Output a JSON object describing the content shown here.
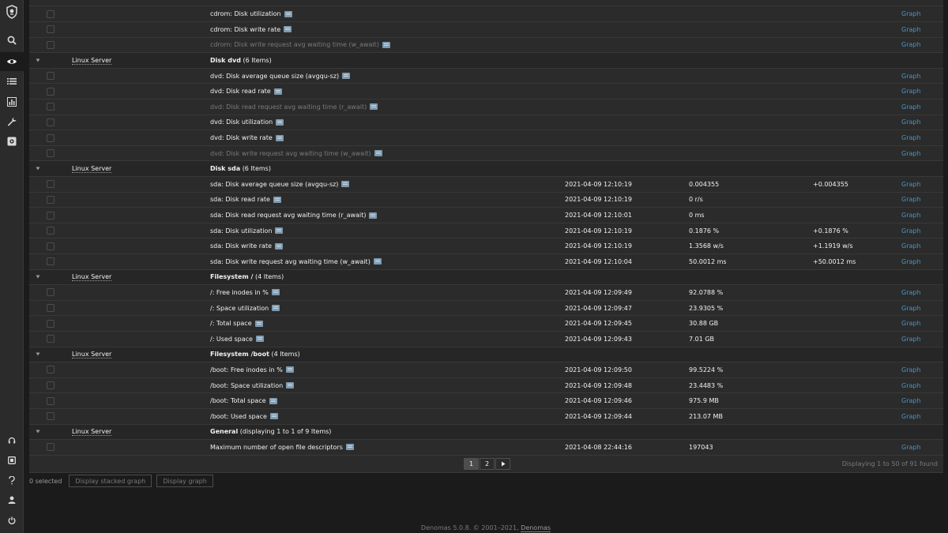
{
  "sidebar": {
    "icons": [
      "logo-icon",
      "search-icon",
      "eye-icon",
      "list-icon",
      "chart-icon",
      "wrench-icon",
      "settings-icon",
      "support-icon",
      "share-icon",
      "help-icon",
      "user-icon",
      "power-icon"
    ]
  },
  "table": {
    "pre_rows": [
      {
        "name": "cdrom: Disk utilization",
        "graph": "Graph",
        "disabled": false
      },
      {
        "name": "cdrom: Disk write rate",
        "graph": "Graph",
        "disabled": false
      },
      {
        "name": "cdrom: Disk write request avg waiting time (w_await)",
        "graph": "Graph",
        "disabled": true
      }
    ],
    "groups": [
      {
        "host": "Linux Server",
        "name": "Disk dvd",
        "count": "(6 Items)",
        "rows": [
          {
            "name": "dvd: Disk average queue size (avgqu-sz)",
            "time": "",
            "last": "",
            "change": "",
            "graph": "Graph",
            "disabled": false
          },
          {
            "name": "dvd: Disk read rate",
            "time": "",
            "last": "",
            "change": "",
            "graph": "Graph",
            "disabled": false
          },
          {
            "name": "dvd: Disk read request avg waiting time (r_await)",
            "time": "",
            "last": "",
            "change": "",
            "graph": "Graph",
            "disabled": true
          },
          {
            "name": "dvd: Disk utilization",
            "time": "",
            "last": "",
            "change": "",
            "graph": "Graph",
            "disabled": false
          },
          {
            "name": "dvd: Disk write rate",
            "time": "",
            "last": "",
            "change": "",
            "graph": "Graph",
            "disabled": false
          },
          {
            "name": "dvd: Disk write request avg waiting time (w_await)",
            "time": "",
            "last": "",
            "change": "",
            "graph": "Graph",
            "disabled": true
          }
        ]
      },
      {
        "host": "Linux Server",
        "name": "Disk sda",
        "count": "(6 Items)",
        "rows": [
          {
            "name": "sda: Disk average queue size (avgqu-sz)",
            "time": "2021-04-09 12:10:19",
            "last": "0.004355",
            "change": "+0.004355",
            "graph": "Graph",
            "disabled": false
          },
          {
            "name": "sda: Disk read rate",
            "time": "2021-04-09 12:10:19",
            "last": "0 r/s",
            "change": "",
            "graph": "Graph",
            "disabled": false
          },
          {
            "name": "sda: Disk read request avg waiting time (r_await)",
            "time": "2021-04-09 12:10:01",
            "last": "0 ms",
            "change": "",
            "graph": "Graph",
            "disabled": false
          },
          {
            "name": "sda: Disk utilization",
            "time": "2021-04-09 12:10:19",
            "last": "0.1876 %",
            "change": "+0.1876 %",
            "graph": "Graph",
            "disabled": false
          },
          {
            "name": "sda: Disk write rate",
            "time": "2021-04-09 12:10:19",
            "last": "1.3568 w/s",
            "change": "+1.1919 w/s",
            "graph": "Graph",
            "disabled": false
          },
          {
            "name": "sda: Disk write request avg waiting time (w_await)",
            "time": "2021-04-09 12:10:04",
            "last": "50.0012 ms",
            "change": "+50.0012 ms",
            "graph": "Graph",
            "disabled": false
          }
        ]
      },
      {
        "host": "Linux Server",
        "name": "Filesystem /",
        "count": "(4 Items)",
        "rows": [
          {
            "name": "/: Free inodes in %",
            "time": "2021-04-09 12:09:49",
            "last": "92.0788 %",
            "change": "",
            "graph": "Graph",
            "disabled": false
          },
          {
            "name": "/: Space utilization",
            "time": "2021-04-09 12:09:47",
            "last": "23.9305 %",
            "change": "",
            "graph": "Graph",
            "disabled": false
          },
          {
            "name": "/: Total space",
            "time": "2021-04-09 12:09:45",
            "last": "30.88 GB",
            "change": "",
            "graph": "Graph",
            "disabled": false
          },
          {
            "name": "/: Used space",
            "time": "2021-04-09 12:09:43",
            "last": "7.01 GB",
            "change": "",
            "graph": "Graph",
            "disabled": false
          }
        ]
      },
      {
        "host": "Linux Server",
        "name": "Filesystem /boot",
        "count": "(4 Items)",
        "rows": [
          {
            "name": "/boot: Free inodes in %",
            "time": "2021-04-09 12:09:50",
            "last": "99.5224 %",
            "change": "",
            "graph": "Graph",
            "disabled": false
          },
          {
            "name": "/boot: Space utilization",
            "time": "2021-04-09 12:09:48",
            "last": "23.4483 %",
            "change": "",
            "graph": "Graph",
            "disabled": false
          },
          {
            "name": "/boot: Total space",
            "time": "2021-04-09 12:09:46",
            "last": "975.9 MB",
            "change": "",
            "graph": "Graph",
            "disabled": false
          },
          {
            "name": "/boot: Used space",
            "time": "2021-04-09 12:09:44",
            "last": "213.07 MB",
            "change": "",
            "graph": "Graph",
            "disabled": false
          }
        ]
      },
      {
        "host": "Linux Server",
        "name": "General",
        "count": "(displaying 1 to 1 of 9 Items)",
        "rows": [
          {
            "name": "Maximum number of open file descriptors",
            "time": "2021-04-08 22:44:16",
            "last": "197043",
            "change": "",
            "graph": "Graph",
            "disabled": false
          }
        ]
      }
    ]
  },
  "pagination": {
    "pages": [
      "1",
      "2"
    ],
    "current": "1",
    "next_icon": "next-icon",
    "info": "Displaying 1 to 50 of 91 found"
  },
  "actions": {
    "selected_count": "0 selected",
    "stacked_label": "Display stacked graph",
    "graph_label": "Display graph"
  },
  "footer": {
    "text": "Denomas 5.0.8. © 2001–2021,",
    "link": "Denomas"
  },
  "colors": {
    "background": "#1b1b1b",
    "panel": "#2b2b2b",
    "link": "#4796c4",
    "info_icon": "#7e9bb1"
  }
}
